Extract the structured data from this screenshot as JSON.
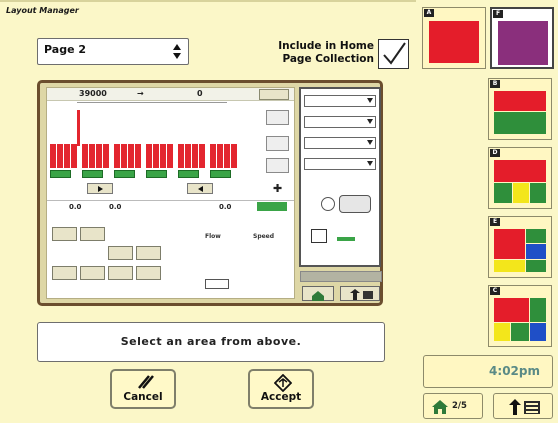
{
  "window": {
    "title": "Layout Manager"
  },
  "page_selector": {
    "value": "Page 2"
  },
  "include_home": {
    "label_line1": "Include in Home",
    "label_line2": "Page Collection",
    "checked": true
  },
  "preview": {
    "left": {
      "top_values": [
        "39000",
        "0"
      ],
      "bottom_values": [
        "0.0",
        "0.0",
        "0.0"
      ],
      "table_labels": [
        "Flow",
        "Speed"
      ]
    },
    "colors": {
      "bar": "#e3262f",
      "section": "#3aa447",
      "frame": "#6b4e2e"
    }
  },
  "message": {
    "text": "Select an area from above."
  },
  "buttons": {
    "cancel": {
      "label": "Cancel"
    },
    "accept": {
      "label": "Accept"
    }
  },
  "layouts": [
    {
      "tag": "A",
      "selected": false
    },
    {
      "tag": "F",
      "selected": true
    },
    {
      "tag": "B",
      "selected": false
    },
    {
      "tag": "D",
      "selected": false
    },
    {
      "tag": "E",
      "selected": false
    },
    {
      "tag": "C",
      "selected": false
    }
  ],
  "status": {
    "time": "4:02pm",
    "page_counter": "2/5"
  },
  "colors": {
    "background": "#fbf7c8",
    "red": "#e41d2a",
    "purple": "#8a2f7c",
    "green": "#2f8f3b",
    "yellow": "#f3e61b",
    "blue": "#1f4fc7",
    "clock": "#5a8a86"
  }
}
